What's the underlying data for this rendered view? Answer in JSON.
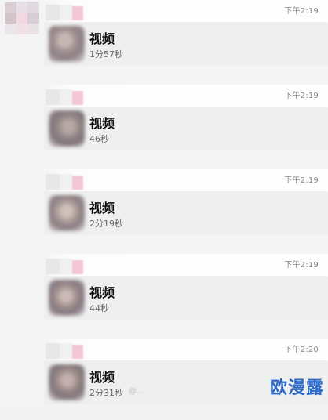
{
  "messages": [
    {
      "time": "下午2:19",
      "title": "视频",
      "duration": "1分57秒"
    },
    {
      "time": "下午2:19",
      "title": "视频",
      "duration": "46秒"
    },
    {
      "time": "下午2:19",
      "title": "视频",
      "duration": "2分19秒"
    },
    {
      "time": "下午2:19",
      "title": "视频",
      "duration": "44秒"
    },
    {
      "time": "下午2:20",
      "title": "视频",
      "duration": "2分31秒"
    }
  ],
  "watermark": {
    "small": "@...",
    "main": "欧漫露"
  },
  "colors": {
    "background": "#f4f4f4",
    "card": "#efefef",
    "time": "#888888",
    "title": "#111111",
    "duration": "#6a6a6a",
    "watermark": "#2b67c9"
  }
}
